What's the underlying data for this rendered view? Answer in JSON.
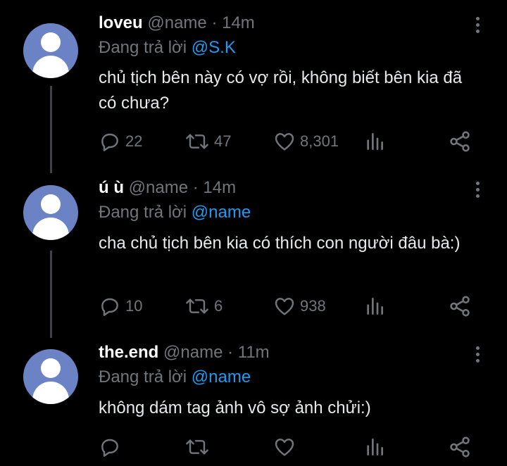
{
  "reply_prefix": "Đang trả lời",
  "tweets": [
    {
      "display_name": "loveu",
      "handle": "@name",
      "separator": "·",
      "time": "14m",
      "reply_to": "@S.K",
      "text": "chủ tịch bên này có vợ rồi, không biết bên kia đã có chưa?",
      "replies": "22",
      "retweets": "47",
      "likes": "8,301"
    },
    {
      "display_name": "ú ù",
      "handle": "@name",
      "separator": "·",
      "time": "14m",
      "reply_to": "@name",
      "text": "cha chủ tịch bên kia có thích con người đâu bà:)",
      "replies": "10",
      "retweets": "6",
      "likes": "938"
    },
    {
      "display_name": "the.end",
      "handle": "@name",
      "separator": "·",
      "time": "11m",
      "reply_to": "@name",
      "text": "không dám tag ảnh vô sợ ảnh chửi:)",
      "replies": "",
      "retweets": "",
      "likes": ""
    }
  ],
  "icons": {
    "reply": "reply-icon",
    "retweet": "retweet-icon",
    "like": "heart-icon",
    "analytics": "analytics-icon",
    "share": "share-icon",
    "more": "more-vertical-icon",
    "avatar": "default-avatar-icon"
  },
  "colors": {
    "background": "#000000",
    "text": "#e7e9ea",
    "muted": "#71767b",
    "mention": "#1d9bf0",
    "avatar": "#6b83c4",
    "thread_line": "#38444d"
  }
}
